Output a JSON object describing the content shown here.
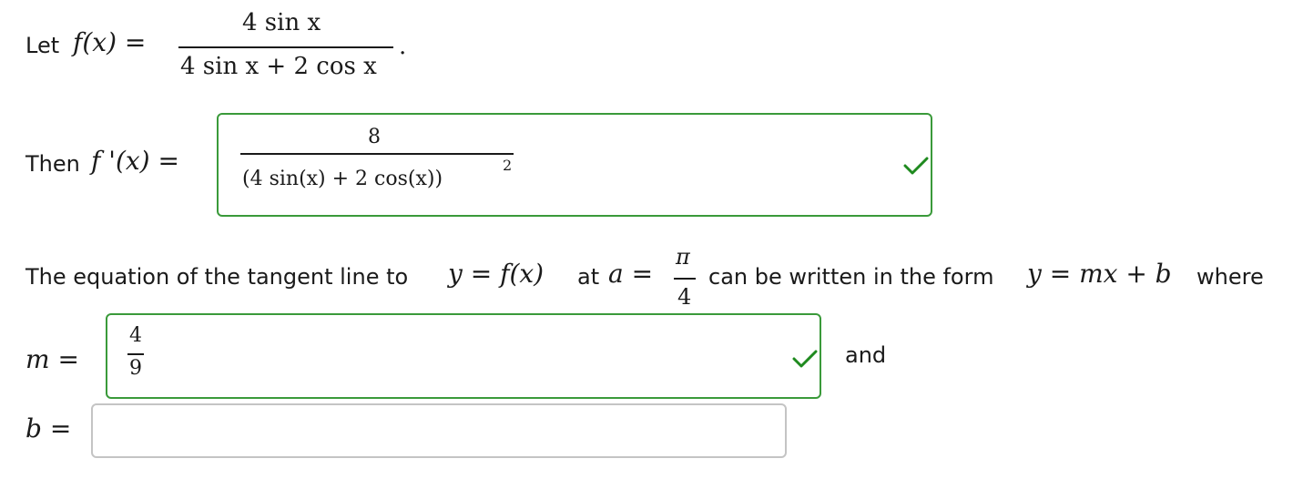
{
  "problem": {
    "let_label": "Let",
    "f_def": {
      "lhs": "f(x) =",
      "numerator": "4 sin x",
      "denominator": "4 sin x + 2 cos x",
      "end_punct": "."
    },
    "then_label": "Then",
    "deriv_lhs": "f '(x) =",
    "deriv_answer": {
      "numerator": "8",
      "denominator": "(4 sin(x) + 2 cos(x))",
      "exponent": "2",
      "status": "correct"
    },
    "tangent_sentence": {
      "part1": "The equation of the tangent line to",
      "eq": "y = f(x)",
      "at": "at",
      "a_eq": "a =",
      "a_num": "π",
      "a_den": "4",
      "part2": "can be written in the form",
      "form": "y = mx + b",
      "where": "where"
    },
    "m_field": {
      "label": "m =",
      "numerator": "4",
      "denominator": "9",
      "status": "correct"
    },
    "and_label": "and",
    "b_field": {
      "label": "b =",
      "value": "",
      "status": "empty"
    }
  },
  "colors": {
    "correct_border": "#3a9a3a",
    "check": "#1f8a1f",
    "empty_border": "#c4c4c4"
  },
  "icons": {
    "check": "checkmark-icon"
  }
}
